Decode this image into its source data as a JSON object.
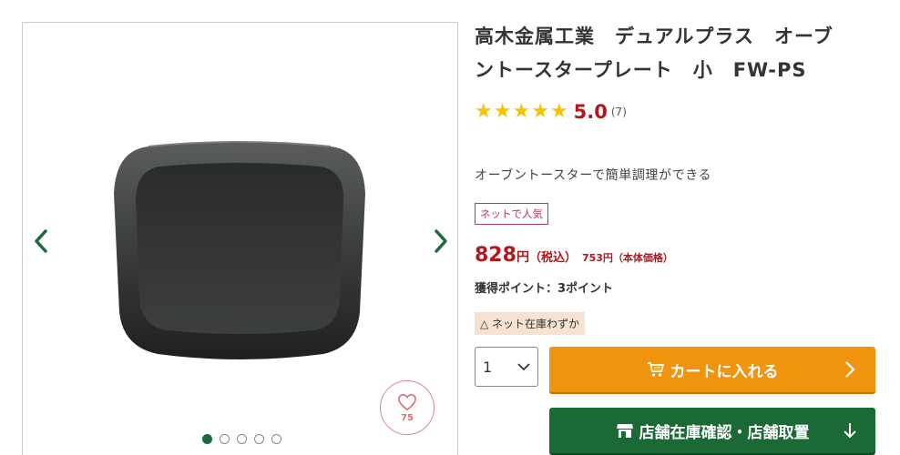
{
  "product": {
    "title_line1": "高木金属工業　デュアルプラス　オーブ",
    "title_line2": "ントースタープレート　小　FW-PS",
    "rating_value": "5.0",
    "rating_stars": 5,
    "review_count": "(7)",
    "lead_text": "オーブントースターで簡単調理ができる",
    "tag": "ネットで人気",
    "price_amount": "828",
    "price_unit": "円",
    "price_tax": "（税込）",
    "price_base": "753円（本体価格）",
    "points": "獲得ポイント：3ポイント",
    "stock": "△ ネット在庫わずか"
  },
  "gallery": {
    "favorite_count": "75",
    "dots": 5,
    "active_dot": 0
  },
  "purchase": {
    "quantity": "1",
    "cart_label": "カートに入れる",
    "store_label": "店舗在庫確認・店舗取置"
  },
  "colors": {
    "accent_red": "#b3161b",
    "cart_orange": "#f0930e",
    "store_green": "#1b6a35",
    "star_yellow": "#f5c400"
  },
  "icons": {
    "prev": "chevron-left-icon",
    "next": "chevron-right-icon",
    "favorite": "heart-icon",
    "cart": "cart-icon",
    "store": "store-icon"
  }
}
